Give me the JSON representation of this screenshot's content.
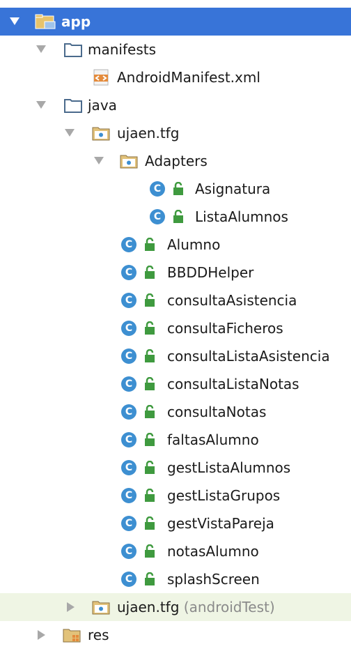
{
  "tree": {
    "app": "app",
    "manifests": "manifests",
    "android_manifest": "AndroidManifest.xml",
    "java": "java",
    "package_main": "ujaen.tfg",
    "adapters": "Adapters",
    "adapter_classes": [
      "Asignatura",
      "ListaAlumnos"
    ],
    "classes": [
      "Alumno",
      "BBDDHelper",
      "consultaAsistencia",
      "consultaFicheros",
      "consultaListaAsistencia",
      "consultaListaNotas",
      "consultaNotas",
      "faltasAlumno",
      "gestListaAlumnos",
      "gestListaGrupos",
      "gestVistaPareja",
      "notasAlumno",
      "splashScreen"
    ],
    "package_test": "ujaen.tfg",
    "package_test_suffix": "(androidTest)",
    "res": "res",
    "class_badge": "C"
  },
  "colors": {
    "selection": "#3874d8",
    "highlight_row": "#eff5e4",
    "class_badge": "#3d8fd1",
    "lock_green": "#3f9a3f"
  }
}
